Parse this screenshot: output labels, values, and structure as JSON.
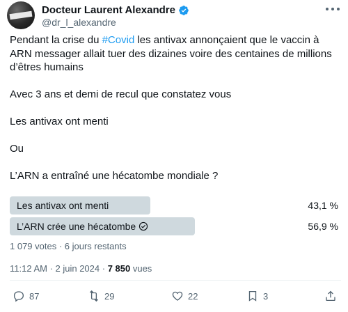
{
  "author": {
    "name": "Docteur Laurent Alexandre",
    "handle": "@dr_l_alexandre",
    "verified": true
  },
  "tweet": {
    "line1_pre": "Pendant la crise du ",
    "hashtag": "#Covid",
    "line1_post": " les antivax annonçaient que le vaccin à ARN messager allait tuer des dizaines voire des centaines de millions d’êtres humains",
    "paragraph2": "Avec 3 ans et demi de recul que constatez vous",
    "paragraph3": "Les antivax ont menti",
    "paragraph4": "Ou",
    "paragraph5": "L’ARN a entraîné une hécatombe mondiale ?"
  },
  "poll": {
    "options": [
      {
        "label": "Les antivax ont menti",
        "percent_text": "43,1 %",
        "percent": 43.1,
        "winner": false
      },
      {
        "label": "L’ARN crée une hécatombe",
        "percent_text": "56,9 %",
        "percent": 56.9,
        "winner": true
      }
    ],
    "meta": "1 079 votes · 6 jours restants"
  },
  "timestamp": {
    "time_date": "11:12 AM · 2 juin 2024 · ",
    "views_count": "7 850",
    "views_label": " vues"
  },
  "actions": {
    "replies": "87",
    "reposts": "29",
    "likes": "22",
    "bookmarks": "3"
  },
  "colors": {
    "accent": "#1d9bf0",
    "poll_bar": "#cfd9de",
    "muted_text": "#536471"
  },
  "icons": [
    "verified-badge-icon",
    "more-icon",
    "reply-icon",
    "repost-icon",
    "like-icon",
    "bookmark-icon",
    "share-icon",
    "check-circle-icon"
  ]
}
